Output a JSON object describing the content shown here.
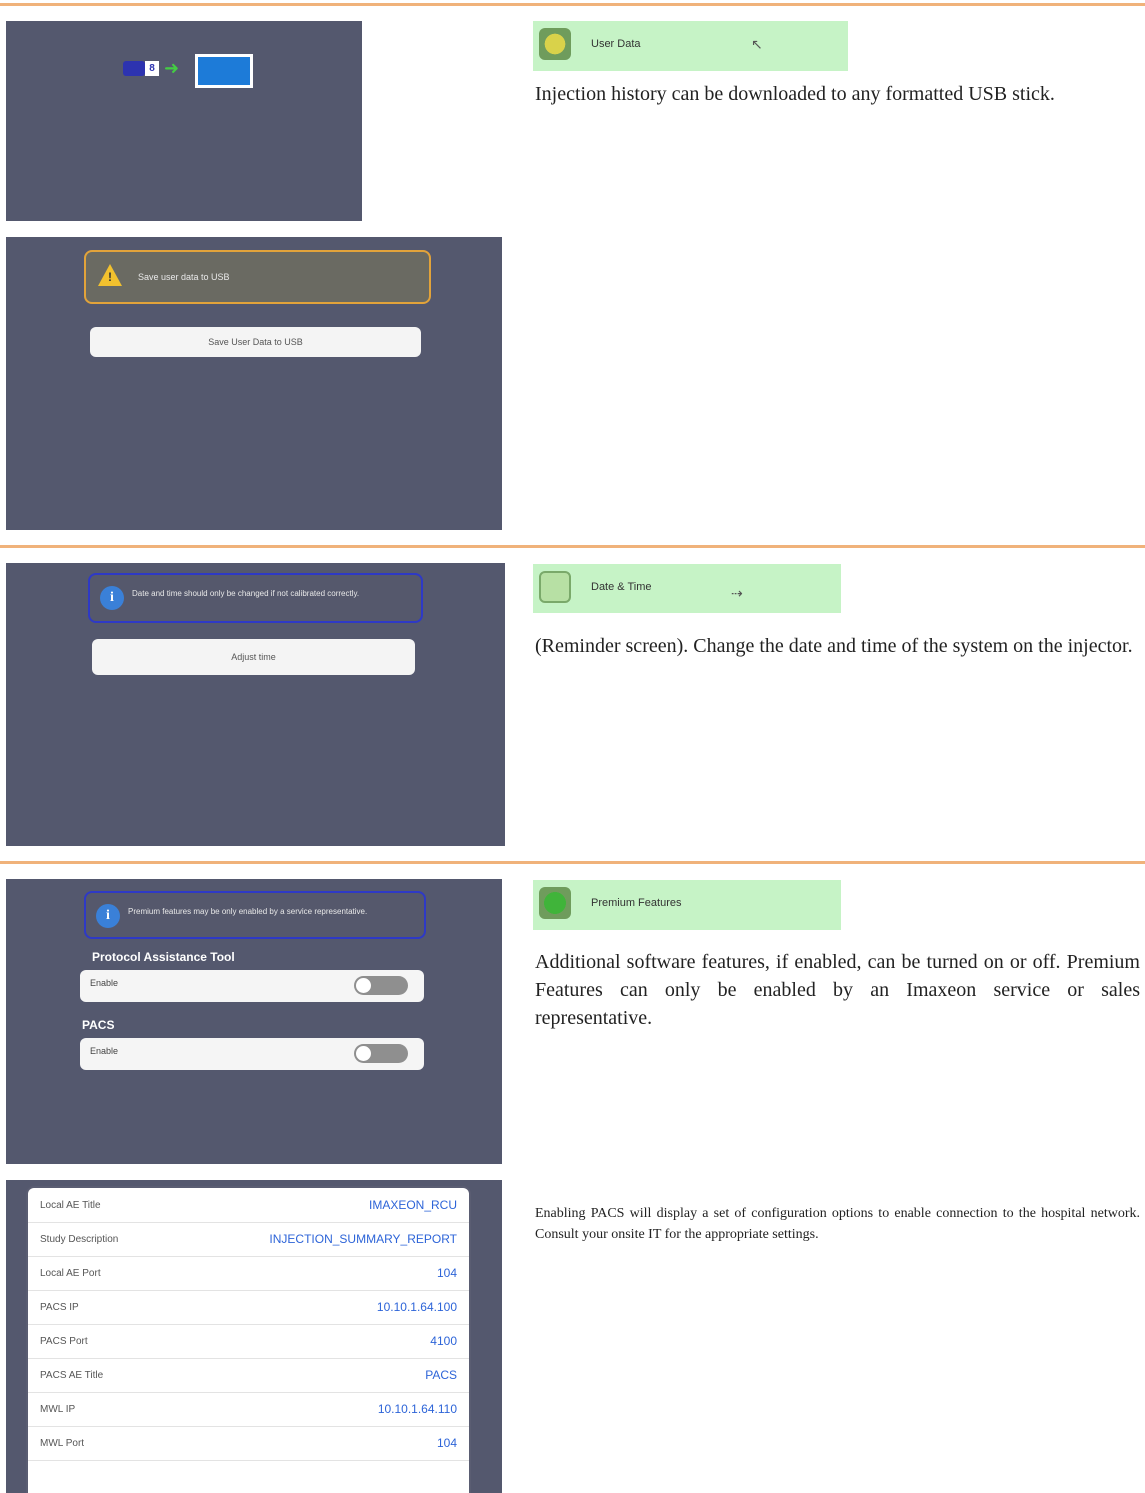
{
  "sections": [
    {
      "header_label": "User Data",
      "description": "Injection history can be downloaded to any formatted USB stick.",
      "usb_label": "8",
      "warning_text": "Save user data to USB",
      "button_label": "Save User Data to USB"
    },
    {
      "header_label": "Date & Time",
      "description": "(Reminder screen). Change the date and time of the system on the injector.",
      "info_text": "Date and time should only be changed if not calibrated correctly.",
      "button_label": "Adjust time"
    },
    {
      "header_label": "Premium Features",
      "description": "Additional software features, if enabled, can be turned on or off. Premium Features can only be enabled by an Imaxeon service or sales representative.",
      "info_text": "Premium features may be only enabled by a service representative.",
      "items": [
        {
          "title": "Protocol Assistance Tool",
          "toggle_label": "Enable"
        },
        {
          "title": "PACS",
          "toggle_label": "Enable"
        }
      ]
    },
    {
      "description": "Enabling PACS will display a set of configuration options to enable connection to the hospital network. Consult your onsite IT for the appropriate settings.",
      "pacs_rows": [
        {
          "key": "Local AE Title",
          "value": "IMAXEON_RCU"
        },
        {
          "key": "Study Description",
          "value": "INJECTION_SUMMARY_REPORT"
        },
        {
          "key": "Local AE Port",
          "value": "104"
        },
        {
          "key": "PACS IP",
          "value": "10.10.1.64.100"
        },
        {
          "key": "PACS Port",
          "value": "4100"
        },
        {
          "key": "PACS AE Title",
          "value": "PACS"
        },
        {
          "key": "MWL IP",
          "value": "10.10.1.64.110"
        },
        {
          "key": "MWL Port",
          "value": "104"
        }
      ]
    }
  ]
}
